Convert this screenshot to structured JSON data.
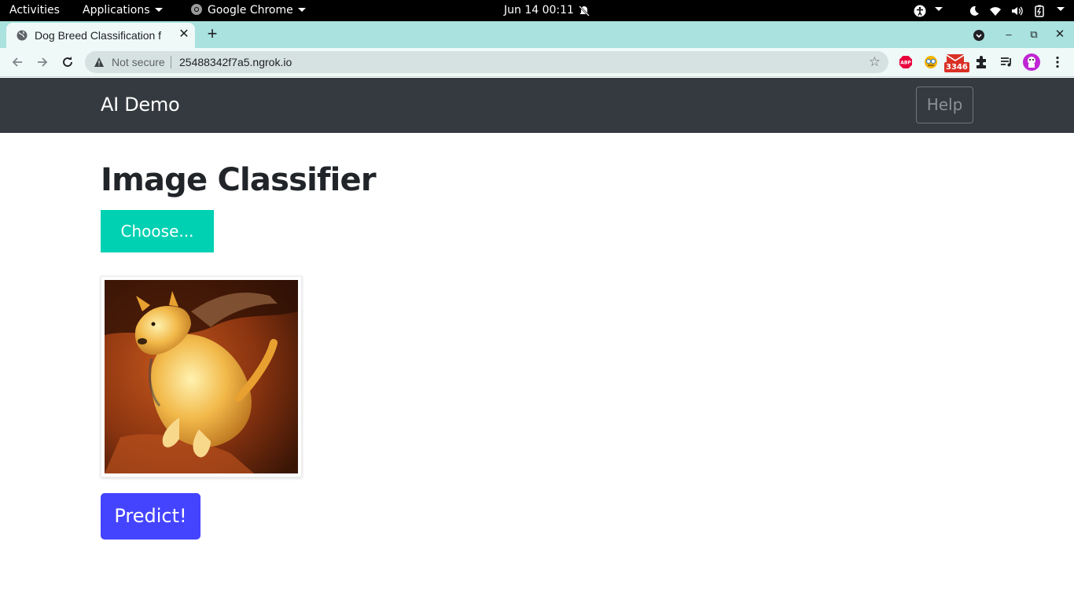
{
  "os_bar": {
    "activities": "Activities",
    "applications": "Applications",
    "active_app": "Google Chrome",
    "clock": "Jun 14  00:11"
  },
  "browser": {
    "tab_title": "Dog Breed Classification f",
    "security": "Not secure",
    "url": "25488342f7a5.ngrok.io",
    "badge_count": "3346",
    "extension_abp": "ABP"
  },
  "page": {
    "brand": "AI Demo",
    "help_label": "Help",
    "heading": "Image Classifier",
    "choose_label": "Choose...",
    "predict_label": "Predict!",
    "image_icon": "dog-photo",
    "colors": {
      "navbar": "#343a40",
      "choose_button": "#00d1b2",
      "predict_button": "#4444ff"
    }
  }
}
